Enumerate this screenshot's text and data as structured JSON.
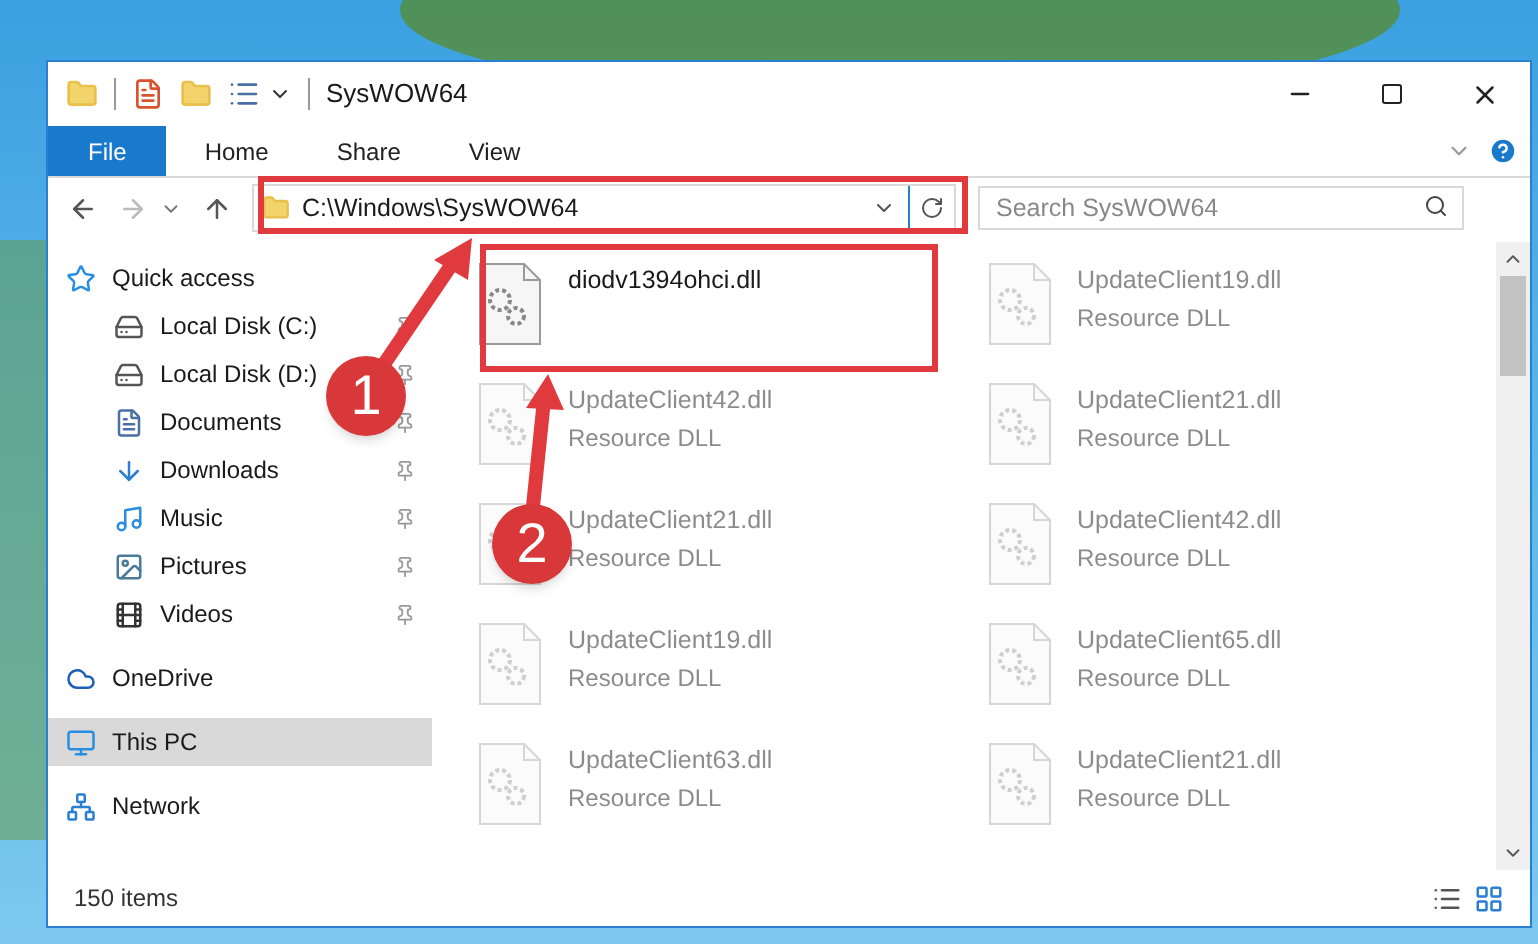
{
  "window": {
    "title": "SysWOW64"
  },
  "ribbon": {
    "tabs": [
      {
        "label": "File",
        "selected": true
      },
      {
        "label": "Home",
        "selected": false
      },
      {
        "label": "Share",
        "selected": false
      },
      {
        "label": "View",
        "selected": false
      }
    ]
  },
  "address_bar": {
    "path": "C:\\Windows\\SysWOW64"
  },
  "search": {
    "placeholder": "Search SysWOW64"
  },
  "sidebar": {
    "items": [
      {
        "label": "Quick access",
        "kind": "star",
        "selected": false,
        "children": [
          {
            "label": "Local Disk (C:)",
            "kind": "drive-c",
            "pinned": true,
            "selected": false
          },
          {
            "label": "Local Disk (D:)",
            "kind": "drive",
            "pinned": true,
            "selected": false
          },
          {
            "label": "Documents",
            "kind": "documents",
            "pinned": true,
            "selected": false
          },
          {
            "label": "Downloads",
            "kind": "downloads",
            "pinned": true,
            "selected": false
          },
          {
            "label": "Music",
            "kind": "music",
            "pinned": true,
            "selected": false
          },
          {
            "label": "Pictures",
            "kind": "pictures",
            "pinned": true,
            "selected": false
          },
          {
            "label": "Videos",
            "kind": "videos",
            "pinned": true,
            "selected": false
          }
        ]
      },
      {
        "label": "OneDrive",
        "kind": "cloud",
        "selected": false
      },
      {
        "label": "This PC",
        "kind": "pc",
        "selected": true
      },
      {
        "label": "Network",
        "kind": "network",
        "selected": false
      }
    ]
  },
  "files": [
    {
      "name": "diodv1394ohci.dll",
      "blurred": false
    },
    {
      "name": "UpdateClient19.dll",
      "type": "Resource DLL",
      "blurred": true
    },
    {
      "name": "UpdateClient42.dll",
      "type": "Resource DLL",
      "blurred": true
    },
    {
      "name": "UpdateClient21.dll",
      "type": "Resource DLL",
      "blurred": true
    },
    {
      "name": "UpdateClient21.dll",
      "type": "Resource DLL",
      "blurred": true
    },
    {
      "name": "UpdateClient42.dll",
      "type": "Resource DLL",
      "blurred": true
    },
    {
      "name": "UpdateClient19.dll",
      "type": "Resource DLL",
      "blurred": true
    },
    {
      "name": "UpdateClient65.dll",
      "type": "Resource DLL",
      "blurred": true
    },
    {
      "name": "UpdateClient63.dll",
      "type": "Resource DLL",
      "blurred": true
    },
    {
      "name": "UpdateClient21.dll",
      "type": "Resource DLL",
      "blurred": true
    }
  ],
  "status_bar": {
    "item_count": "150 items"
  },
  "annotations": [
    {
      "number": "1"
    },
    {
      "number": "2"
    }
  ]
}
